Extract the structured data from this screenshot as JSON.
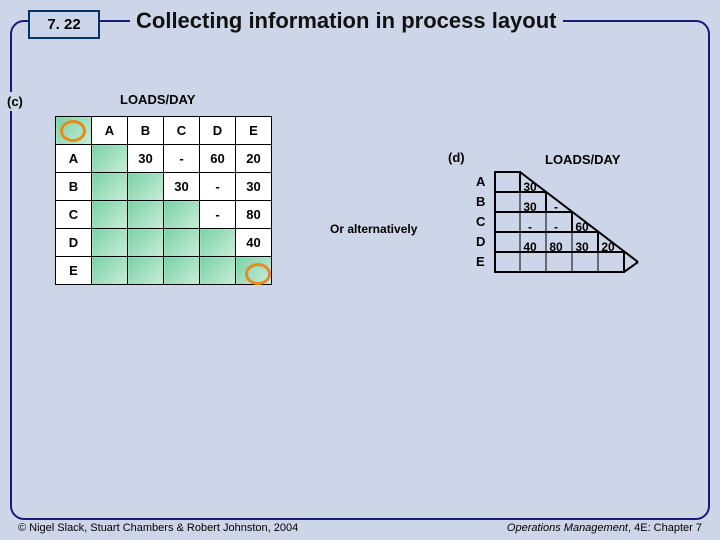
{
  "slide_number": "7. 22",
  "title": "Collecting information in process layout",
  "section_c": {
    "label": "(c)",
    "caption": "LOADS/DAY",
    "col_headers": [
      "A",
      "B",
      "C",
      "D",
      "E"
    ],
    "row_headers": [
      "A",
      "B",
      "C",
      "D",
      "E"
    ],
    "cells": {
      "A_B": "30",
      "A_C": "-",
      "A_D": "60",
      "A_E": "20",
      "B_C": "30",
      "B_D": "-",
      "B_E": "30",
      "C_D": "-",
      "C_E": "80",
      "D_E": "40"
    }
  },
  "or_alt": "Or alternatively",
  "section_d": {
    "label": "(d)",
    "caption": "LOADS/DAY",
    "row_headers": [
      "A",
      "B",
      "C",
      "D",
      "E"
    ],
    "cells": {
      "r0": [
        "30"
      ],
      "r1": [
        "30",
        "-"
      ],
      "r2": [
        "-",
        "-",
        "60"
      ],
      "r3": [
        "40",
        "80",
        "30",
        "20"
      ]
    }
  },
  "footer": {
    "left": "© Nigel Slack, Stuart Chambers & Robert Johnston, 2004",
    "right_italic": "Operations Management",
    "right_plain": ", 4E: Chapter 7"
  }
}
